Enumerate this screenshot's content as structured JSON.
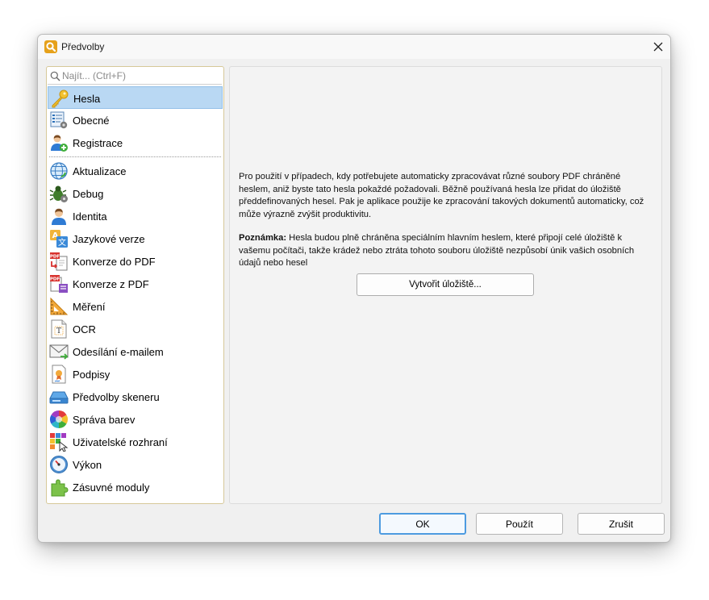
{
  "window": {
    "title": "Předvolby",
    "close_label": "✕"
  },
  "search": {
    "placeholder": "Najít... (Ctrl+F)",
    "value": ""
  },
  "sidebar": {
    "items": [
      {
        "label": "Hesla",
        "icon": "key-icon",
        "selected": true
      },
      {
        "label": "Obecné",
        "icon": "general-settings-icon"
      },
      {
        "label": "Registrace",
        "icon": "user-add-icon"
      },
      {
        "label": "Aktualizace",
        "icon": "globe-update-icon"
      },
      {
        "label": "Debug",
        "icon": "bug-icon"
      },
      {
        "label": "Identita",
        "icon": "person-icon"
      },
      {
        "label": "Jazykové verze",
        "icon": "language-icon"
      },
      {
        "label": "Konverze do PDF",
        "icon": "convert-to-pdf-icon"
      },
      {
        "label": "Konverze z PDF",
        "icon": "convert-from-pdf-icon"
      },
      {
        "label": "Měření",
        "icon": "ruler-icon"
      },
      {
        "label": "OCR",
        "icon": "ocr-icon"
      },
      {
        "label": "Odesílání e-mailem",
        "icon": "email-icon"
      },
      {
        "label": "Podpisy",
        "icon": "signature-icon"
      },
      {
        "label": "Předvolby skeneru",
        "icon": "scanner-icon"
      },
      {
        "label": "Správa barev",
        "icon": "color-wheel-icon"
      },
      {
        "label": "Uživatelské rozhraní",
        "icon": "user-interface-icon"
      },
      {
        "label": "Výkon",
        "icon": "performance-gauge-icon"
      },
      {
        "label": "Zásuvné moduly",
        "icon": "plugin-icon"
      }
    ]
  },
  "main": {
    "description": "Pro použití v případech, kdy potřebujete automaticky zpracovávat různé soubory PDF chráněné heslem, aniž byste tato hesla pokaždé požadovali. Běžně používaná hesla lze přidat do úložiště předdefinovaných hesel. Pak je aplikace použije ke zpracování takových dokumentů automaticky, což může výrazně zvýšit produktivitu.",
    "note_label": "Poznámka:",
    "note_text": " Hesla budou plně chráněna speciálním hlavním heslem, které připojí celé úložiště k vašemu počítači, takže krádež nebo ztráta tohoto souboru úložiště nezpůsobí únik vašich osobních údajů nebo hesel",
    "create_button": "Vytvořit úložiště..."
  },
  "footer": {
    "ok": "OK",
    "apply": "Použít",
    "cancel": "Zrušit"
  },
  "colors": {
    "selection": "#b9d8f3",
    "panel_border": "#d6c899",
    "primary_button_border": "#4d9be0"
  }
}
